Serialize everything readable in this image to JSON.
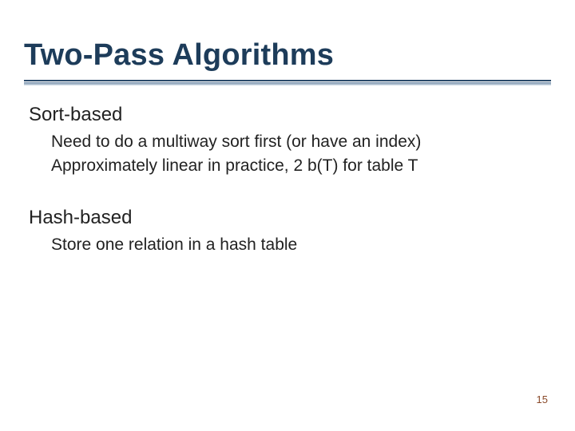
{
  "title": "Two-Pass Algorithms",
  "sections": [
    {
      "heading": "Sort-based",
      "lines": [
        "Need to do a multiway sort first (or have an index)",
        "Approximately linear in practice, 2 b(T) for table T"
      ]
    },
    {
      "heading": "Hash-based",
      "lines": [
        "Store one relation in a hash table"
      ]
    }
  ],
  "page_number": "15"
}
